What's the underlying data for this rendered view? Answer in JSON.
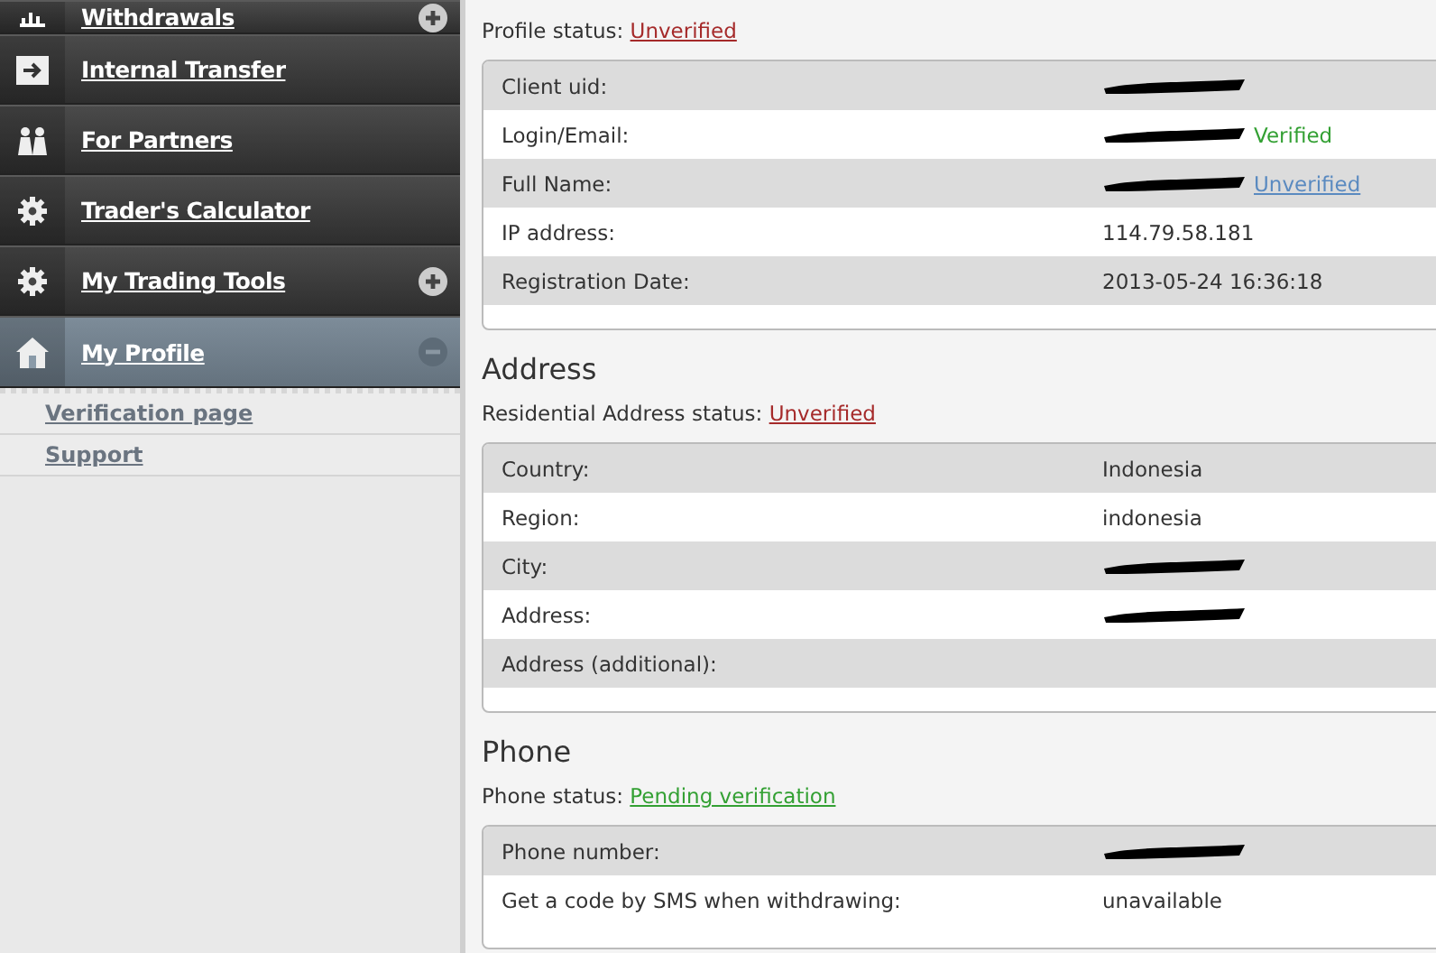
{
  "sidebar": {
    "items": [
      {
        "label": "Withdrawals",
        "kind": "chart",
        "selected": false,
        "expanded": false
      },
      {
        "label": "Internal Transfer",
        "kind": "arrow",
        "selected": false
      },
      {
        "label": "For Partners",
        "kind": "people",
        "selected": false
      },
      {
        "label": "Trader's Calculator",
        "kind": "gear",
        "selected": false
      },
      {
        "label": "My Trading Tools",
        "kind": "gear",
        "selected": false,
        "expanded": false
      },
      {
        "label": "My Profile",
        "kind": "house",
        "selected": true,
        "expanded": true,
        "children": [
          {
            "label": "Verification page"
          },
          {
            "label": "Support"
          }
        ]
      }
    ]
  },
  "sections": [
    {
      "status": {
        "label": "Profile status:",
        "value": "Unverified",
        "kind": "unverified"
      },
      "rows": [
        {
          "label": "Client uid:",
          "redacted": true
        },
        {
          "label": "Login/Email:",
          "redacted": true,
          "badge": {
            "text": "Verified",
            "kind": "verified"
          }
        },
        {
          "label": "Full Name:",
          "redacted": true,
          "badge": {
            "text": "Unverified",
            "kind": "link"
          }
        },
        {
          "label": "IP address:",
          "value": "114.79.58.181"
        },
        {
          "label": "Registration Date:",
          "value": "2013-05-24 16:36:18"
        }
      ]
    },
    {
      "heading": "Address",
      "status": {
        "label": "Residential Address status:",
        "value": "Unverified",
        "kind": "unverified"
      },
      "rows": [
        {
          "label": "Country:",
          "value": "Indonesia"
        },
        {
          "label": "Region:",
          "value": "indonesia"
        },
        {
          "label": "City:",
          "redacted": true
        },
        {
          "label": "Address:",
          "redacted": true
        },
        {
          "label": "Address (additional):"
        }
      ]
    },
    {
      "heading": "Phone",
      "status": {
        "label": "Phone status:",
        "value": "Pending verification",
        "kind": "pending"
      },
      "rows": [
        {
          "label": "Phone number:",
          "redacted": true
        },
        {
          "label": "Get a code by SMS when withdrawing:",
          "value": "unavailable"
        }
      ]
    }
  ]
}
